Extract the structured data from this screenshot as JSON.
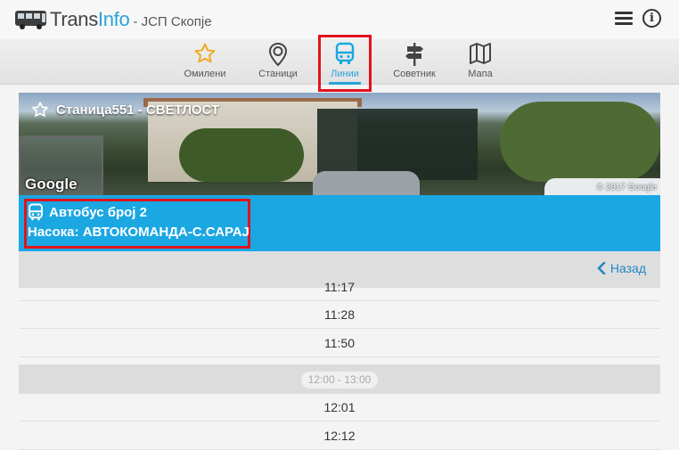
{
  "header": {
    "brand_trans": "Trans",
    "brand_info": "Info",
    "brand_sub": "- ЈСП Скопје",
    "icons": [
      "bus-logo-icon",
      "hamburger-menu-icon",
      "info-icon"
    ],
    "info_glyph": "i"
  },
  "nav": {
    "items": [
      {
        "label": "Омилени",
        "icon": "star-icon",
        "active": false
      },
      {
        "label": "Станици",
        "icon": "map-pin-icon",
        "active": false
      },
      {
        "label": "Линии",
        "icon": "bus-icon",
        "active": true
      },
      {
        "label": "Советник",
        "icon": "signpost-icon",
        "active": false
      },
      {
        "label": "Мапа",
        "icon": "map-icon",
        "active": false
      }
    ]
  },
  "station": {
    "title": "Станица551 - СВЕТЛОСТ",
    "google_label": "Google",
    "copyright": "© 2017 Google"
  },
  "route": {
    "bus_label": "Автобус број 2",
    "direction": "Насока: АВТОКОМАНДА-С.САРАЈ"
  },
  "back": {
    "label": "Назад"
  },
  "schedule": {
    "rows_before": [
      "11:17",
      "11:28",
      "11:50"
    ],
    "hour_range": "12:00 - 13:00",
    "rows_after": [
      "12:01",
      "12:12"
    ]
  },
  "colors": {
    "accent": "#1ba7e2",
    "highlight": "#e1131d",
    "link": "#2187c8"
  }
}
